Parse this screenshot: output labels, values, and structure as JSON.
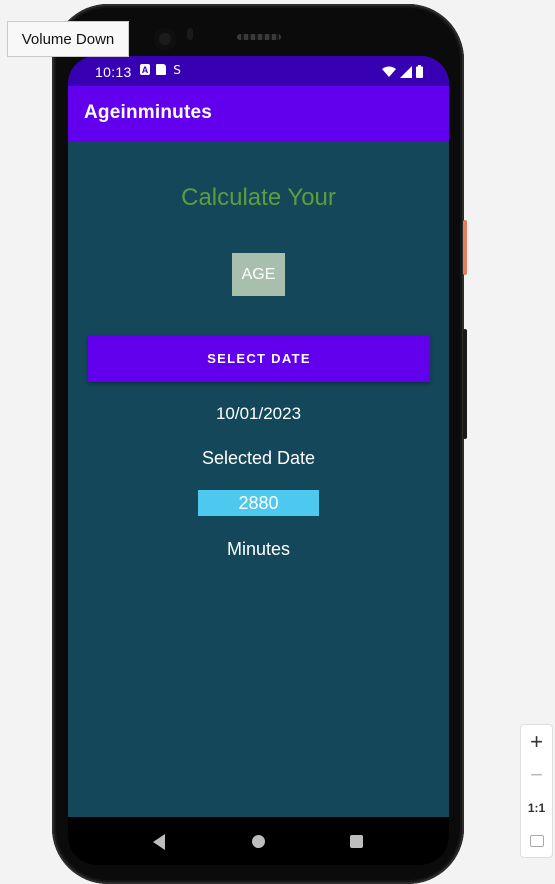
{
  "tooltip": {
    "label": "Volume Down"
  },
  "status_bar": {
    "time": "10:13",
    "icons": [
      "a-notification-icon",
      "sim-card-icon",
      "s-notification-icon",
      "wifi-icon",
      "signal-icon",
      "battery-icon"
    ]
  },
  "app_bar": {
    "title": "Ageinminutes"
  },
  "main": {
    "headline": "Calculate Your",
    "age_label": "AGE",
    "select_button_label": "SELECT DATE",
    "date_value": "10/01/2023",
    "selected_date_label": "Selected Date",
    "minutes_value": "2880",
    "minutes_label": "Minutes"
  },
  "nav_bar": {
    "buttons": [
      "back-icon",
      "home-icon",
      "recents-icon"
    ]
  },
  "zoom_controls": {
    "zoom_in": "+",
    "zoom_out": "−",
    "actual_size": "1:1",
    "fit": "fit-screen-icon"
  },
  "colors": {
    "status_bar": "#3700b3",
    "app_bar": "#6200ee",
    "background": "#134759",
    "headline": "#5c9e3c",
    "age_box": "#a9bfae",
    "button": "#6200ee",
    "minutes_box": "#4dc9ef"
  }
}
